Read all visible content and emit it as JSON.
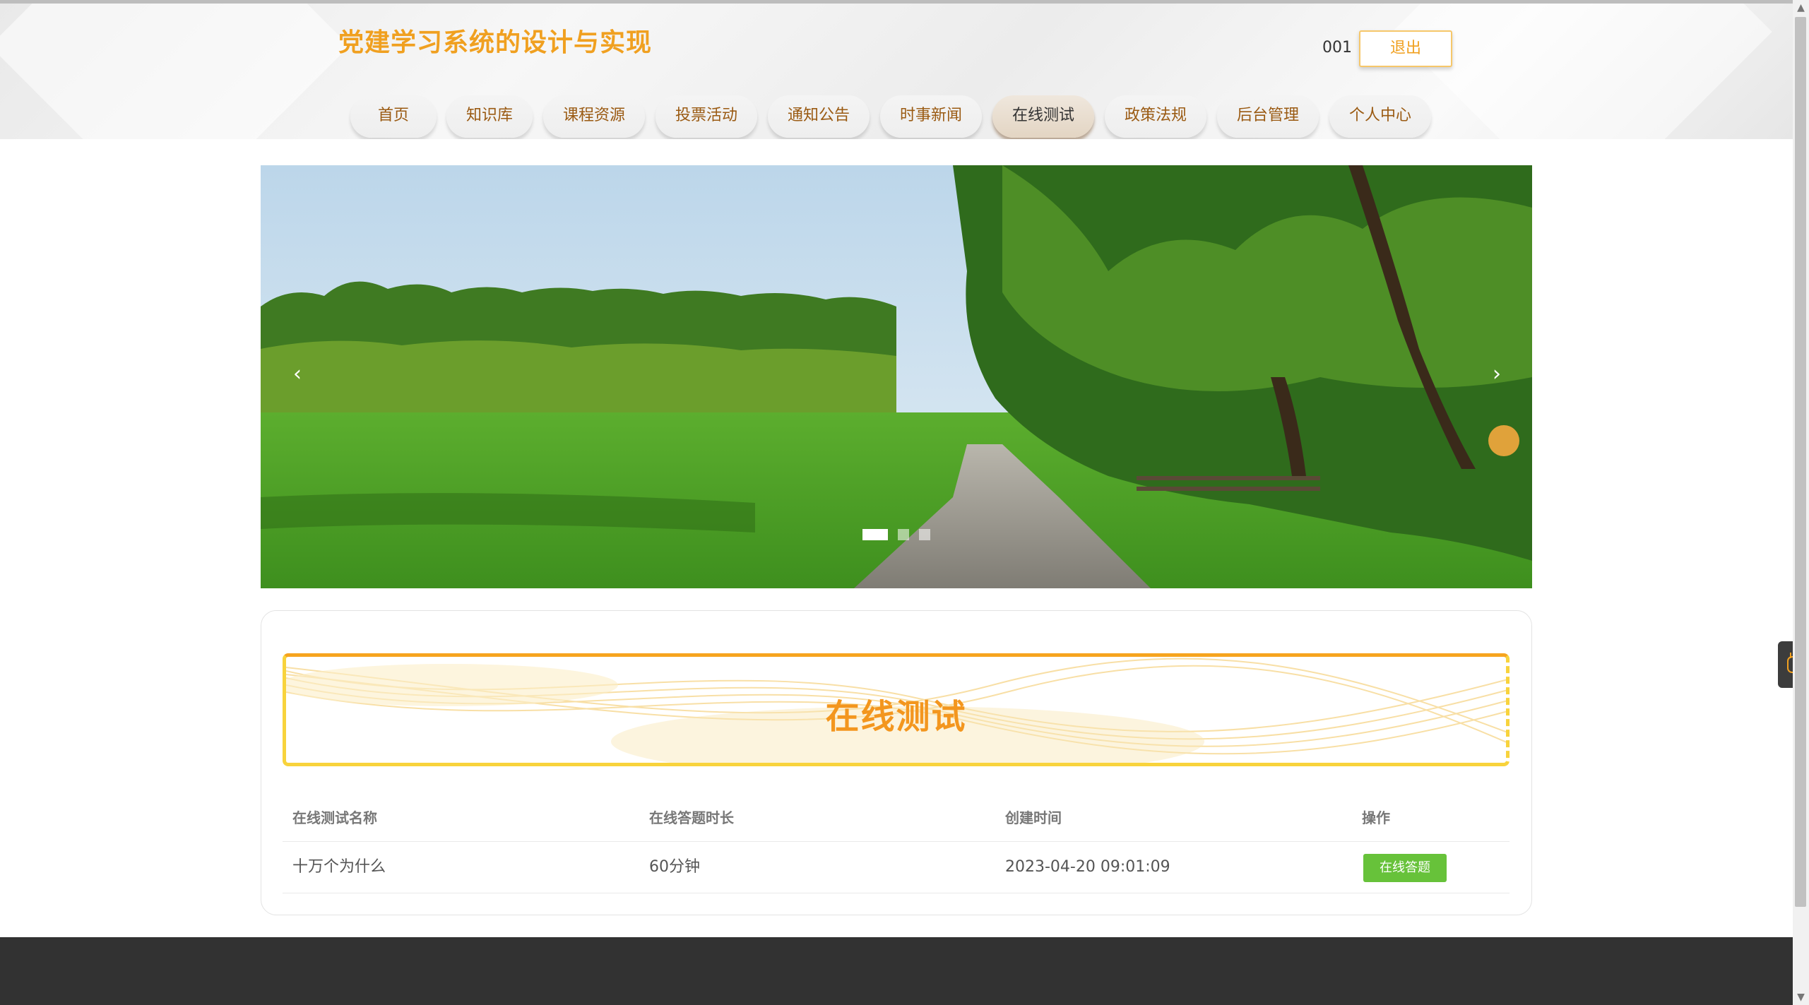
{
  "header": {
    "site_title": "党建学习系统的设计与实现",
    "user_name": "001",
    "logout_label": "退出"
  },
  "nav": {
    "items": [
      {
        "label": "首页"
      },
      {
        "label": "知识库"
      },
      {
        "label": "课程资源"
      },
      {
        "label": "投票活动"
      },
      {
        "label": "通知公告"
      },
      {
        "label": "时事新闻"
      },
      {
        "label": "在线测试"
      },
      {
        "label": "政策法规"
      },
      {
        "label": "后台管理"
      },
      {
        "label": "个人中心"
      }
    ],
    "active_label": "在线测试"
  },
  "carousel": {
    "prev_icon": "‹",
    "next_icon": "›",
    "slide_count": 3,
    "active_slide": 1
  },
  "section": {
    "title": "在线测试"
  },
  "table": {
    "columns": [
      "在线测试名称",
      "在线答题时长",
      "创建时间",
      "操作"
    ],
    "rows": [
      {
        "name": "十万个为什么",
        "duration": "60分钟",
        "created": "2023-04-20 09:01:09",
        "action_label": "在线答题"
      }
    ]
  },
  "colors": {
    "accent": "#f0a020",
    "action_button": "#67c23a",
    "footer": "#323232",
    "active_nav": "#e3d5c3"
  }
}
